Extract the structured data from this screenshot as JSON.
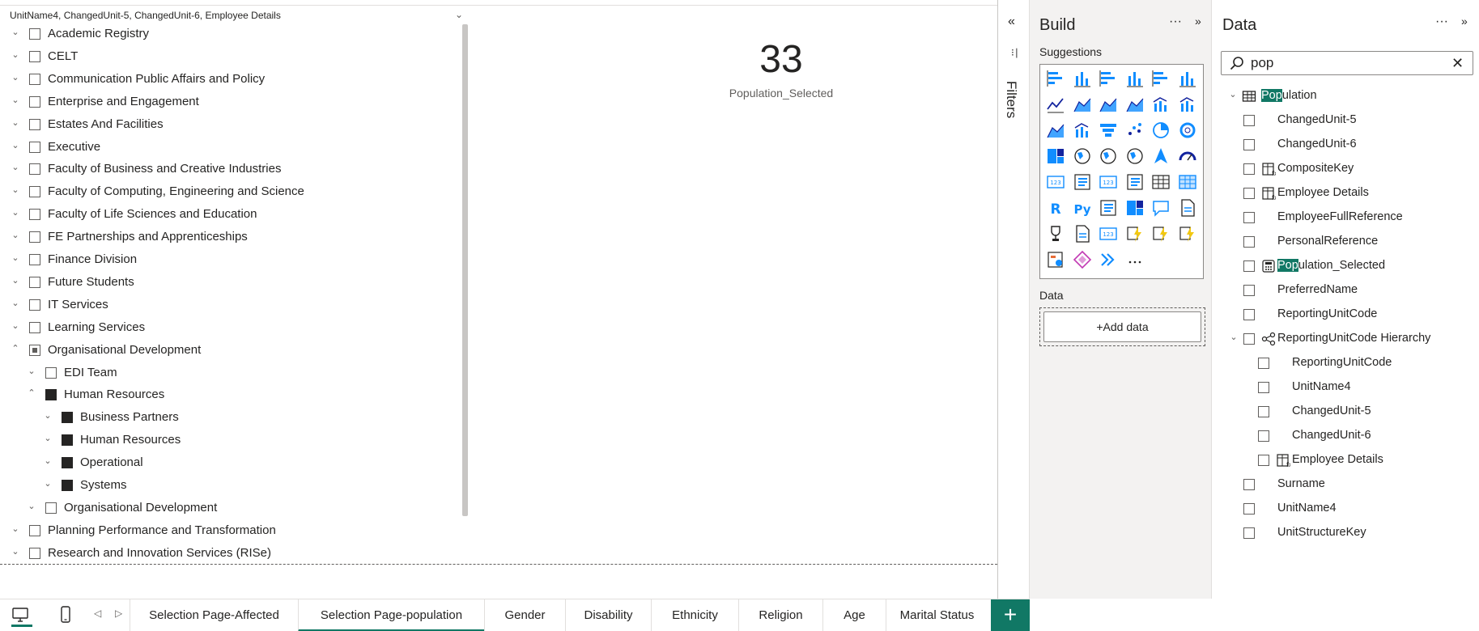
{
  "slicer": {
    "header": "UnitName4, ChangedUnit-5, ChangedUnit-6, Employee Details",
    "items": [
      {
        "label": "Academic Registry",
        "level": 0,
        "state": "none",
        "exp": "down"
      },
      {
        "label": "CELT",
        "level": 0,
        "state": "none",
        "exp": "down"
      },
      {
        "label": "Communication Public Affairs and Policy",
        "level": 0,
        "state": "none",
        "exp": "down"
      },
      {
        "label": "Enterprise and Engagement",
        "level": 0,
        "state": "none",
        "exp": "down"
      },
      {
        "label": "Estates And Facilities",
        "level": 0,
        "state": "none",
        "exp": "down"
      },
      {
        "label": "Executive",
        "level": 0,
        "state": "none",
        "exp": "down"
      },
      {
        "label": "Faculty of Business and Creative Industries",
        "level": 0,
        "state": "none",
        "exp": "down"
      },
      {
        "label": "Faculty of Computing, Engineering and Science",
        "level": 0,
        "state": "none",
        "exp": "down"
      },
      {
        "label": "Faculty of Life Sciences and Education",
        "level": 0,
        "state": "none",
        "exp": "down"
      },
      {
        "label": "FE Partnerships and Apprenticeships",
        "level": 0,
        "state": "none",
        "exp": "down"
      },
      {
        "label": "Finance Division",
        "level": 0,
        "state": "none",
        "exp": "down"
      },
      {
        "label": "Future Students",
        "level": 0,
        "state": "none",
        "exp": "down"
      },
      {
        "label": "IT Services",
        "level": 0,
        "state": "none",
        "exp": "down"
      },
      {
        "label": "Learning Services",
        "level": 0,
        "state": "none",
        "exp": "down"
      },
      {
        "label": "Organisational Development",
        "level": 0,
        "state": "partial",
        "exp": "up"
      },
      {
        "label": "EDI Team",
        "level": 1,
        "state": "none",
        "exp": "down"
      },
      {
        "label": "Human Resources",
        "level": 1,
        "state": "full",
        "exp": "up"
      },
      {
        "label": "Business Partners",
        "level": 2,
        "state": "full",
        "exp": "down"
      },
      {
        "label": "Human Resources",
        "level": 2,
        "state": "full",
        "exp": "down"
      },
      {
        "label": "Operational",
        "level": 2,
        "state": "full",
        "exp": "down"
      },
      {
        "label": "Systems",
        "level": 2,
        "state": "full",
        "exp": "down"
      },
      {
        "label": "Organisational Development",
        "level": 1,
        "state": "none",
        "exp": "down"
      },
      {
        "label": "Planning Performance and Transformation",
        "level": 0,
        "state": "none",
        "exp": "down"
      },
      {
        "label": "Research and Innovation Services (RISe)",
        "level": 0,
        "state": "none",
        "exp": "down"
      }
    ]
  },
  "card": {
    "value": "33",
    "label": "Population_Selected"
  },
  "filters": {
    "label": "Filters"
  },
  "build": {
    "title": "Build",
    "more": "···",
    "suggestions_label": "Suggestions",
    "data_label": "Data",
    "add_data": "+Add data",
    "visuals": [
      "stacked-bar-icon",
      "stacked-column-icon",
      "clustered-bar-icon",
      "clustered-column-icon",
      "100-bar-icon",
      "100-column-icon",
      "line-icon",
      "area-icon",
      "stacked-area-icon",
      "100-area-icon",
      "line-column-icon",
      "line-clustered-icon",
      "ribbon-icon",
      "waterfall-icon",
      "funnel-icon",
      "scatter-icon",
      "pie-icon",
      "donut-icon",
      "treemap-icon",
      "map-icon",
      "filled-map-icon",
      "shape-map-icon",
      "azure-map-icon",
      "gauge-icon",
      "card-icon",
      "multirow-card-icon",
      "kpi-icon",
      "slicer-icon",
      "table-icon",
      "matrix-icon",
      "r-visual-icon",
      "python-visual-icon",
      "key-influencers-icon",
      "decomposition-tree-icon",
      "qa-icon",
      "smart-narrative-icon",
      "trophy-icon",
      "paginated-report-icon",
      "card-new-icon",
      "power-apps-icon",
      "power-automate-icon",
      "slicer-new-icon",
      "metrics-icon",
      "azure-icon",
      "ai-narrative-icon",
      "more-visuals-icon"
    ],
    "more_visuals": "···"
  },
  "datapane": {
    "title": "Data",
    "more": "···",
    "search_value": "pop",
    "table": {
      "hl": "Pop",
      "rest": "ulation"
    },
    "fields": [
      {
        "label": "ChangedUnit-5",
        "indent": 0,
        "icon": "none"
      },
      {
        "label": "ChangedUnit-6",
        "indent": 0,
        "icon": "none"
      },
      {
        "label": "CompositeKey",
        "indent": 0,
        "icon": "calc-column-icon"
      },
      {
        "label": "Employee Details",
        "indent": 0,
        "icon": "calc-column-icon"
      },
      {
        "label": "EmployeeFullReference",
        "indent": 0,
        "icon": "none"
      },
      {
        "label": "PersonalReference",
        "indent": 0,
        "icon": "none"
      },
      {
        "label": "Population_Selected",
        "indent": 0,
        "icon": "measure-icon",
        "hl": "Pop",
        "rest": "ulation_Selected"
      },
      {
        "label": "PreferredName",
        "indent": 0,
        "icon": "none"
      },
      {
        "label": "ReportingUnitCode",
        "indent": 0,
        "icon": "none"
      },
      {
        "label": "ReportingUnitCode Hierarchy",
        "indent": 0,
        "icon": "hierarchy-icon",
        "exp": true
      },
      {
        "label": "ReportingUnitCode",
        "indent": 1,
        "icon": "none"
      },
      {
        "label": "UnitName4",
        "indent": 1,
        "icon": "none"
      },
      {
        "label": "ChangedUnit-5",
        "indent": 1,
        "icon": "none"
      },
      {
        "label": "ChangedUnit-6",
        "indent": 1,
        "icon": "none"
      },
      {
        "label": "Employee Details",
        "indent": 1,
        "icon": "calc-column-icon"
      },
      {
        "label": "Surname",
        "indent": 0,
        "icon": "none"
      },
      {
        "label": "UnitName4",
        "indent": 0,
        "icon": "none"
      },
      {
        "label": "UnitStructureKey",
        "indent": 0,
        "icon": "none"
      }
    ]
  },
  "pages": {
    "tabs": [
      {
        "label": "Selection Page-Affected",
        "active": false
      },
      {
        "label": "Selection Page-population",
        "active": true
      },
      {
        "label": "Gender",
        "active": false
      },
      {
        "label": "Disability",
        "active": false
      },
      {
        "label": "Ethnicity",
        "active": false
      },
      {
        "label": "Religion",
        "active": false
      },
      {
        "label": "Age",
        "active": false
      },
      {
        "label": "Marital Status",
        "active": false
      }
    ],
    "add": "+"
  },
  "colors": {
    "accent": "#117865",
    "visual_blue": "#118dff",
    "visual_dark": "#12239e"
  }
}
